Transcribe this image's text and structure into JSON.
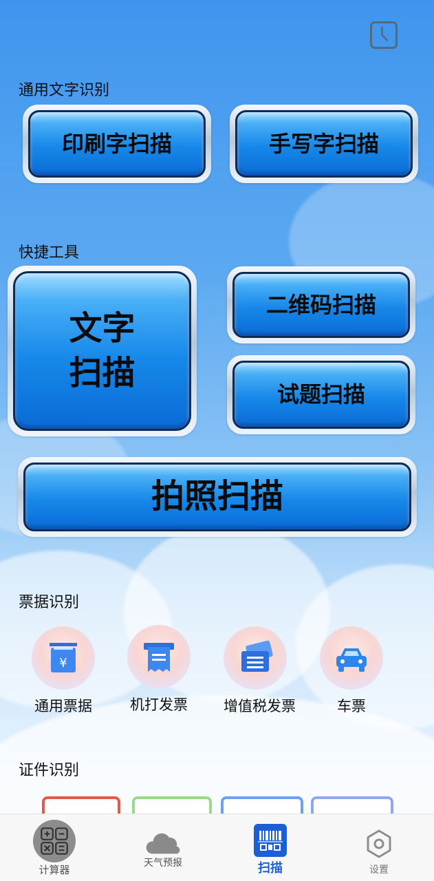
{
  "header": {
    "history_icon": "clock-icon"
  },
  "sections": {
    "general": {
      "title": "通用文字识别",
      "print_label": "印刷字扫描",
      "handwrite_label": "手写字扫描"
    },
    "tools": {
      "title": "快捷工具",
      "text_scan_label": "文字\n扫描",
      "qr_label": "二维码扫描",
      "exam_label": "试题扫描",
      "photo_label": "拍照扫描"
    },
    "tickets": {
      "title": "票据识别",
      "items": [
        {
          "label": "通用票据",
          "icon": "receipt-yen-icon"
        },
        {
          "label": "机打发票",
          "icon": "printed-invoice-icon"
        },
        {
          "label": "增值税发票",
          "icon": "vat-invoice-icon"
        },
        {
          "label": "车票",
          "icon": "car-icon"
        }
      ]
    },
    "certs": {
      "title": "证件识别"
    }
  },
  "tabbar": {
    "items": [
      {
        "label": "计算器",
        "icon": "calculator-icon"
      },
      {
        "label": "天气预报",
        "icon": "cloud-icon"
      },
      {
        "label": "扫描",
        "icon": "scan-icon"
      },
      {
        "label": "设置",
        "icon": "settings-icon"
      }
    ],
    "active": "扫描"
  },
  "colors": {
    "accent": "#1a5fd6",
    "button_blue": "#1688e9",
    "frame_silver": "#b9c9d9"
  }
}
